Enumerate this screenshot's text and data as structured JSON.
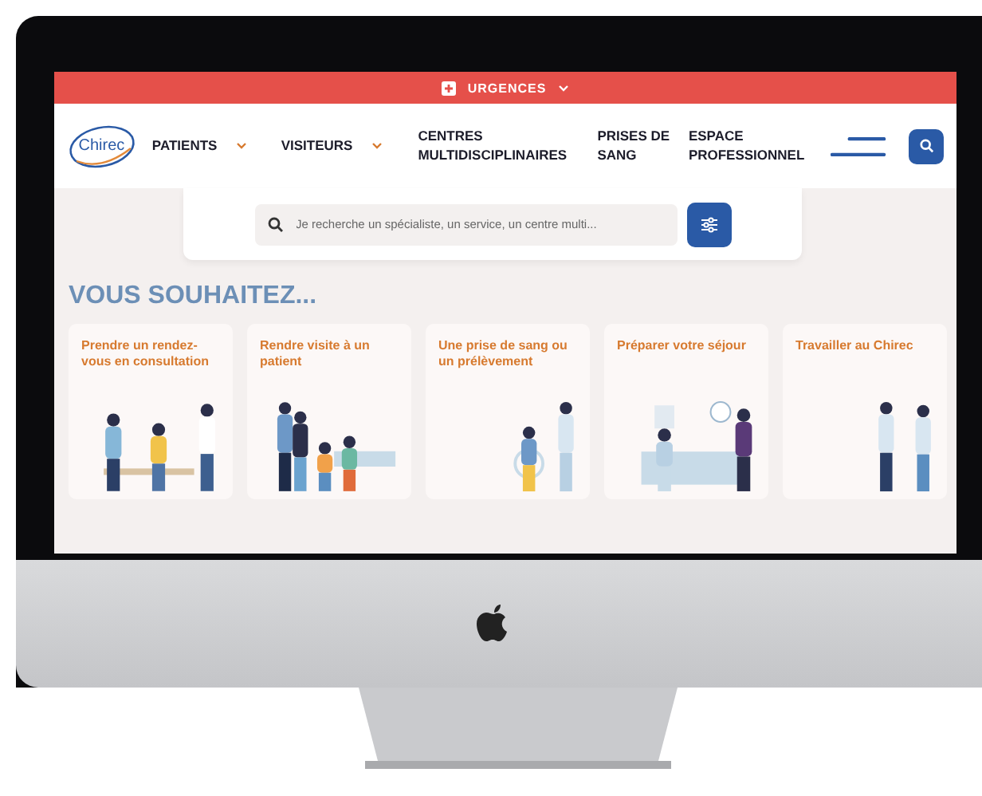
{
  "alert_bar": {
    "label": "URGENCES"
  },
  "logo": {
    "text": "Chirec"
  },
  "nav": [
    {
      "label": "PATIENTS",
      "has_dropdown": true
    },
    {
      "label": "VISITEURS",
      "has_dropdown": true
    },
    {
      "label": "CENTRES MULTIDISCIPLINAIRES",
      "has_dropdown": false
    },
    {
      "label": "PRISES DE SANG",
      "has_dropdown": false
    },
    {
      "label": "ESPACE PROFESSIONNEL",
      "has_dropdown": false
    }
  ],
  "search": {
    "placeholder": "Je recherche un spécialiste, un service, un centre multi..."
  },
  "section_title": "VOUS SOUHAITEZ...",
  "cards": [
    {
      "title": "Prendre un rendez-vous en consultation",
      "kind": "waiting"
    },
    {
      "title": "Rendre visite à un patient",
      "kind": "visit"
    },
    {
      "title": "Une prise de sang ou un prélèvement",
      "kind": "blood"
    },
    {
      "title": "Préparer votre séjour",
      "kind": "reception"
    },
    {
      "title": "Travailler au Chirec",
      "kind": "staff"
    }
  ]
}
